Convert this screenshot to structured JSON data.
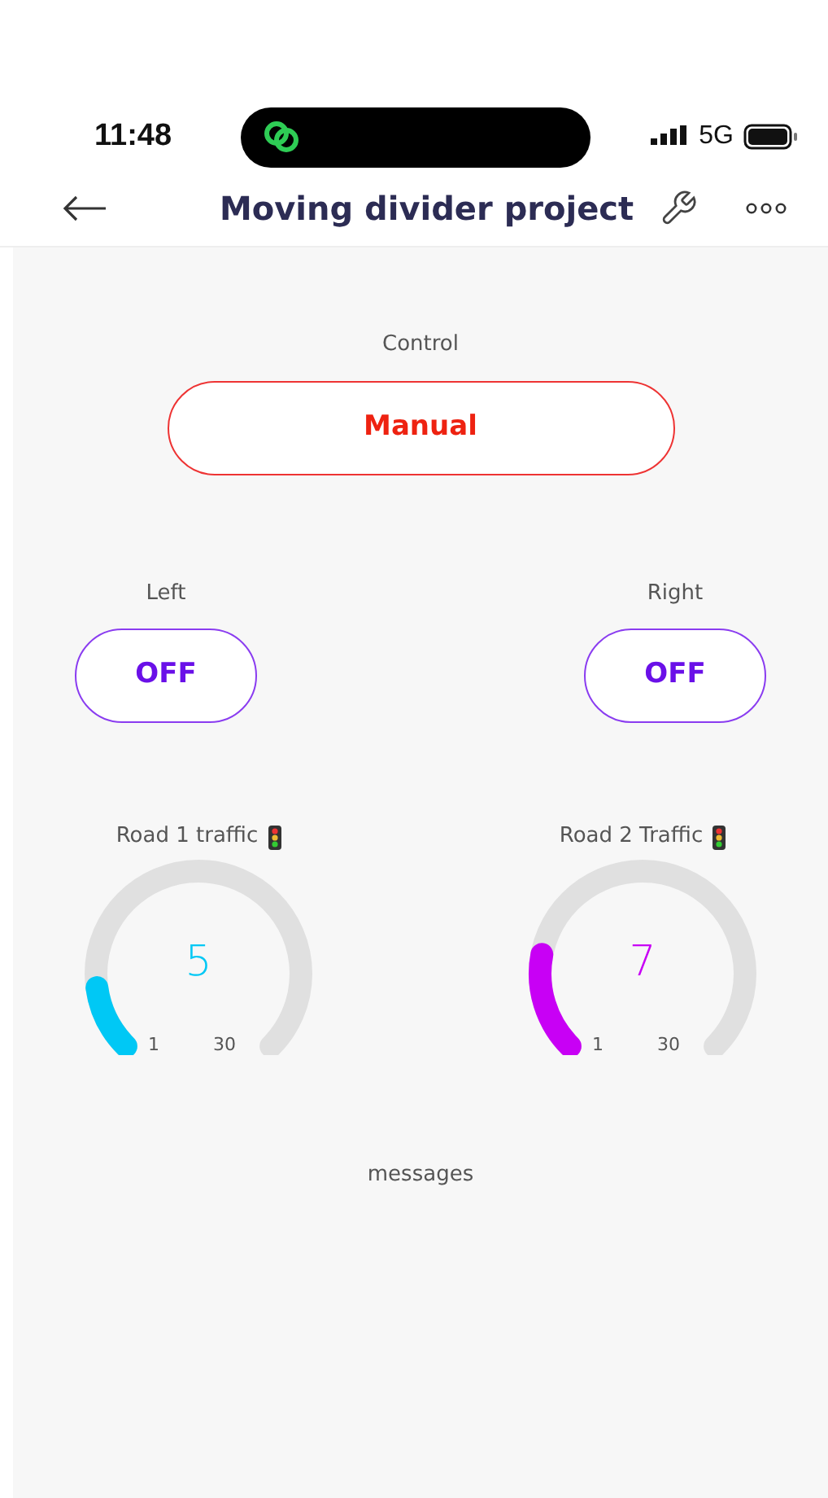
{
  "status_bar": {
    "time": "11:48",
    "network": "5G"
  },
  "header": {
    "title": "Moving divider project"
  },
  "control": {
    "label": "Control",
    "value": "Manual"
  },
  "switches": [
    {
      "label": "Left",
      "value": "OFF"
    },
    {
      "label": "Right",
      "value": "OFF"
    }
  ],
  "gauges": [
    {
      "label": "Road 1 traffic",
      "value": "5",
      "min": "1",
      "max": "30",
      "color": "#00c8f5"
    },
    {
      "label": "Road 2 Traffic",
      "value": "7",
      "min": "1",
      "max": "30",
      "color": "#c800f5"
    }
  ],
  "messages": {
    "label": "messages"
  }
}
